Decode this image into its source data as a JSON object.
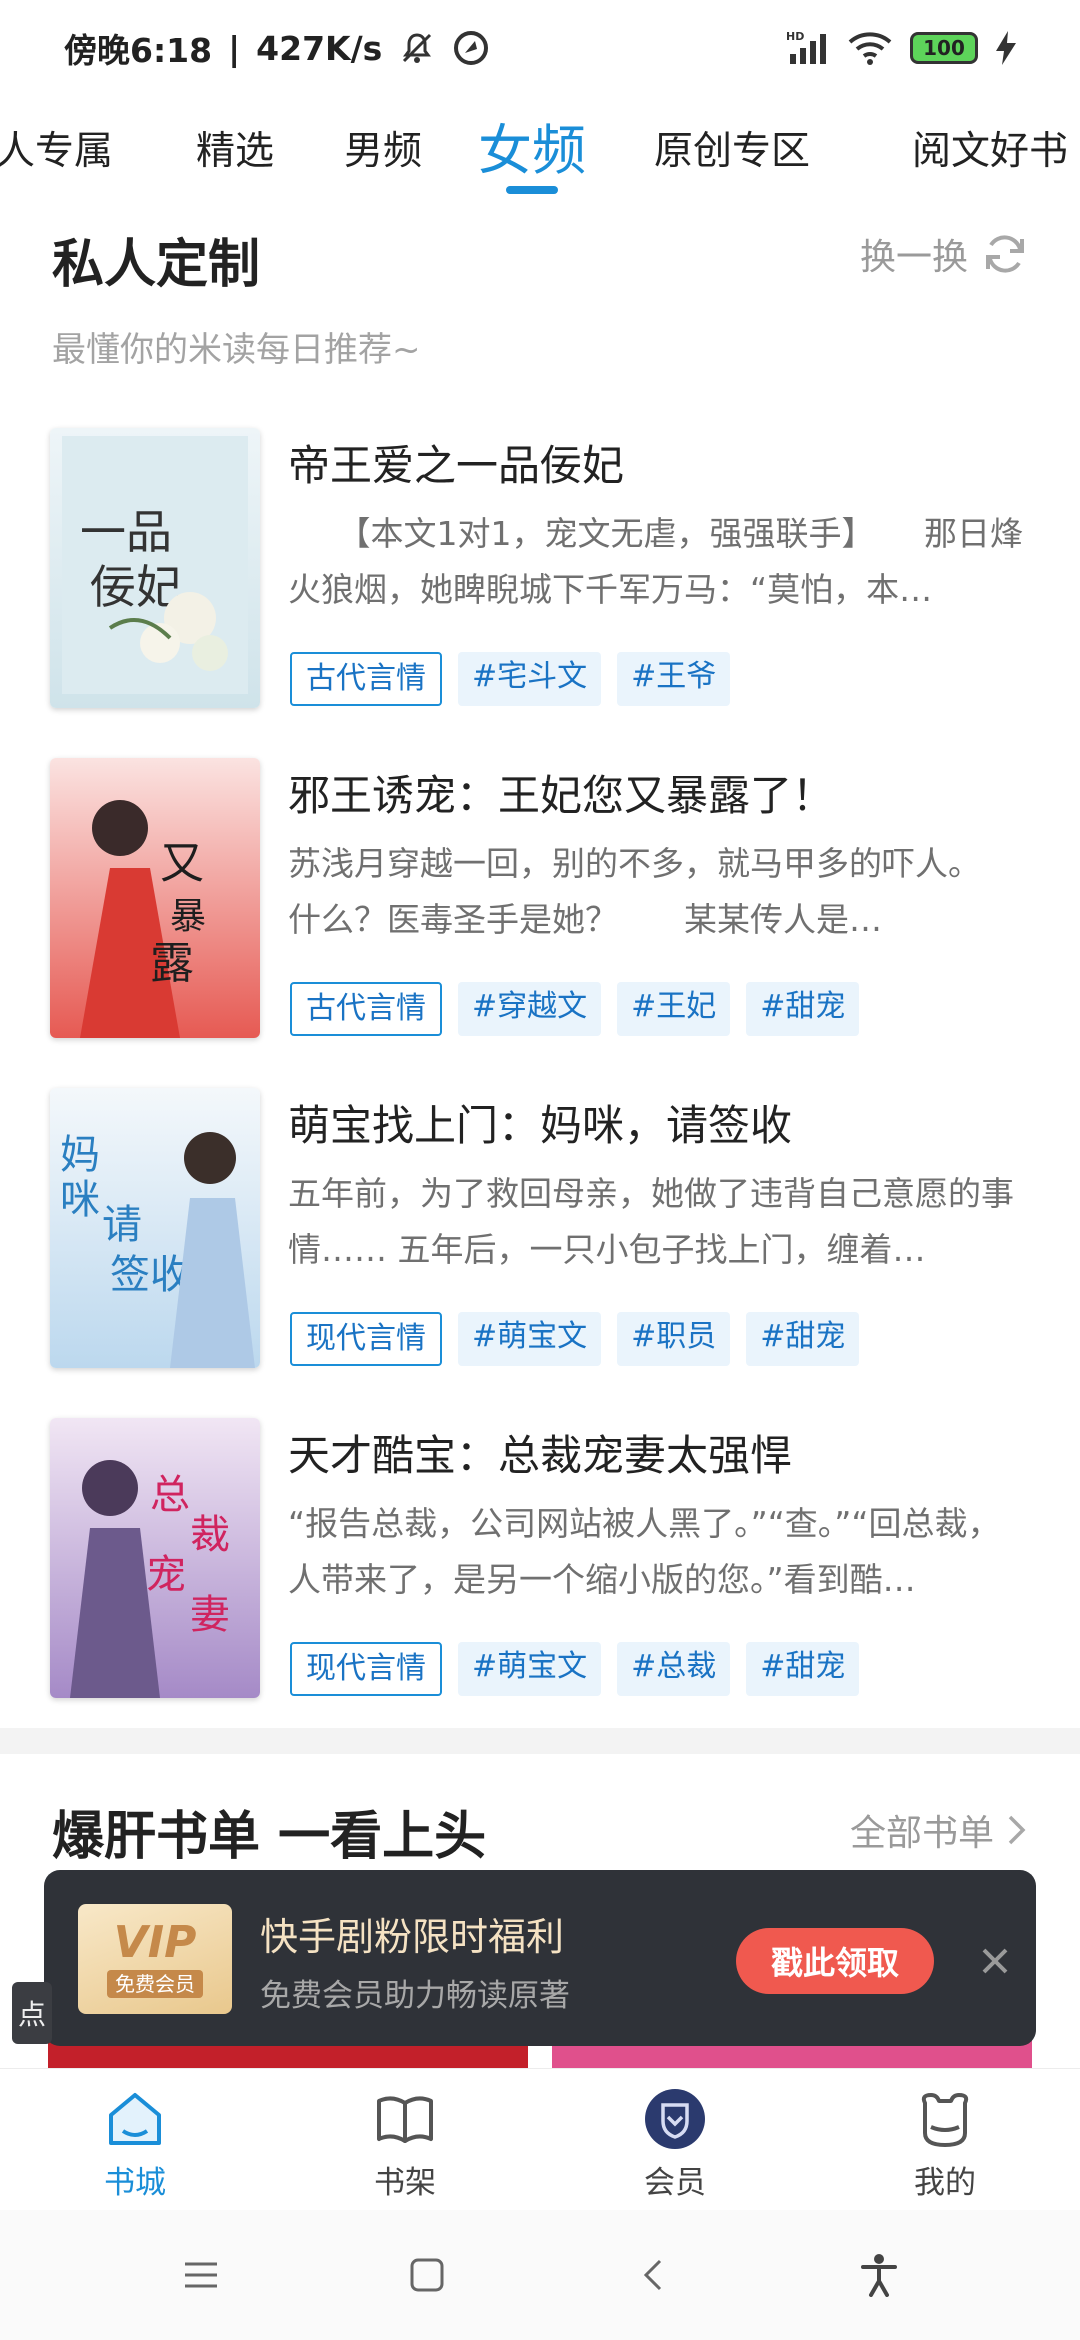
{
  "status_bar": {
    "time": "傍晚6:18",
    "separator": "|",
    "net_speed": "427K/s",
    "battery": "100",
    "icons": [
      "mute-icon",
      "vpn-icon",
      "signal-icon",
      "wifi-icon",
      "battery-icon",
      "charging-icon"
    ],
    "hd_label": "HD"
  },
  "tabs": [
    {
      "label": "人专属"
    },
    {
      "label": "精选"
    },
    {
      "label": "男频"
    },
    {
      "label": "女频",
      "active": true
    },
    {
      "label": "原创专区"
    },
    {
      "label": "阅文好书"
    }
  ],
  "section": {
    "title": "私人定制",
    "refresh_label": "换一换",
    "subtitle": "最懂你的米读每日推荐~"
  },
  "books": [
    {
      "title": "帝王爱之一品佞妃",
      "desc": "　　【本文1对1，宠文无虐，强强联手】　　那日烽火狼烟，她睥睨城下千军万马：“莫怕，本…",
      "tags": [
        "古代言情",
        "#宅斗文",
        "#王爷"
      ]
    },
    {
      "title": "邪王诱宠：王妃您又暴露了！",
      "desc": "苏浅月穿越一回，别的不多，就马甲多的吓人。　　什么？医毒圣手是她？　　某某传人是…",
      "tags": [
        "古代言情",
        "#穿越文",
        "#王妃",
        "#甜宠"
      ]
    },
    {
      "title": "萌宝找上门：妈咪，请签收",
      "desc": "五年前，为了救回母亲，她做了违背自己意愿的事情…… 五年后，一只小包子找上门，缠着…",
      "tags": [
        "现代言情",
        "#萌宝文",
        "#职员",
        "#甜宠"
      ]
    },
    {
      "title": "天才酷宝：总裁宠妻太强悍",
      "desc": "“报告总裁，公司网站被人黑了。”“查。”“回总裁，人带来了，是另一个缩小版的您。”看到酷…",
      "tags": [
        "现代言情",
        "#萌宝文",
        "#总裁",
        "#甜宠"
      ]
    }
  ],
  "section2": {
    "title": "爆肝书单 一看上头",
    "more_label": "全部书单"
  },
  "promo": {
    "badge_text": "VIP",
    "badge_sub": "免费会员",
    "title": "快手剧粉限时福利",
    "subtitle": "免费会员助力畅读原著",
    "button": "戳此领取",
    "side_tab": "点"
  },
  "bottom_nav": [
    {
      "label": "书城",
      "icon": "bookstore-icon",
      "active": true
    },
    {
      "label": "书架",
      "icon": "bookshelf-icon"
    },
    {
      "label": "会员",
      "icon": "vip-shield-icon"
    },
    {
      "label": "我的",
      "icon": "profile-icon"
    }
  ],
  "colors": {
    "accent": "#1a8ed8",
    "promo_bg": "#2f3238",
    "promo_button": "#f0594f"
  }
}
